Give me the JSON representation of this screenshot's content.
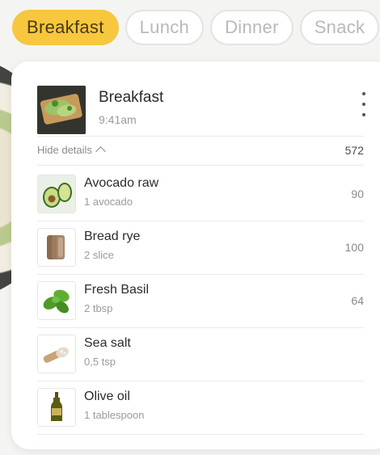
{
  "tabs": [
    {
      "label": "Breakfast",
      "active": true
    },
    {
      "label": "Lunch",
      "active": false
    },
    {
      "label": "Dinner",
      "active": false
    },
    {
      "label": "Snack",
      "active": false
    }
  ],
  "meal": {
    "title": "Breakfast",
    "time": "9:41am",
    "details_toggle": "Hide details",
    "total": "572"
  },
  "items": [
    {
      "name": "Avocado raw",
      "amount": "1 avocado",
      "calories": "90",
      "icon": "avocado-icon"
    },
    {
      "name": "Bread rye",
      "amount": "2 slice",
      "calories": "100",
      "icon": "bread-icon"
    },
    {
      "name": "Fresh Basil",
      "amount": "2 tbsp",
      "calories": "64",
      "icon": "basil-icon"
    },
    {
      "name": "Sea salt",
      "amount": "0,5 tsp",
      "calories": "",
      "icon": "salt-icon"
    },
    {
      "name": "Olive oil",
      "amount": "1 tablespoon",
      "calories": "",
      "icon": "olive-oil-icon"
    }
  ],
  "colors": {
    "accent": "#f7c73e",
    "tab_inactive_text": "#b9b9b9"
  }
}
